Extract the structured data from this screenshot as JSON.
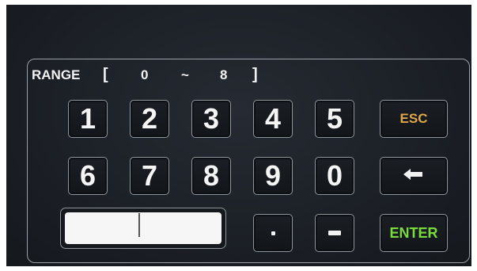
{
  "range": {
    "label": "RANGE",
    "open_bracket": "[",
    "min": "0",
    "separator": "~",
    "max": "8",
    "close_bracket": "]"
  },
  "keypad": {
    "digits": [
      "1",
      "2",
      "3",
      "4",
      "5",
      "6",
      "7",
      "8",
      "9",
      "0"
    ],
    "esc_label": "ESC",
    "enter_label": "ENTER",
    "backspace_icon": "arrow-left-icon",
    "decimal_icon": "decimal-point-icon",
    "minus_icon": "minus-icon"
  },
  "input": {
    "value": ""
  },
  "colors": {
    "esc": "#e0a64a",
    "enter": "#79dc3e",
    "key_text": "#f5f5f5",
    "background": "#1c2027"
  }
}
